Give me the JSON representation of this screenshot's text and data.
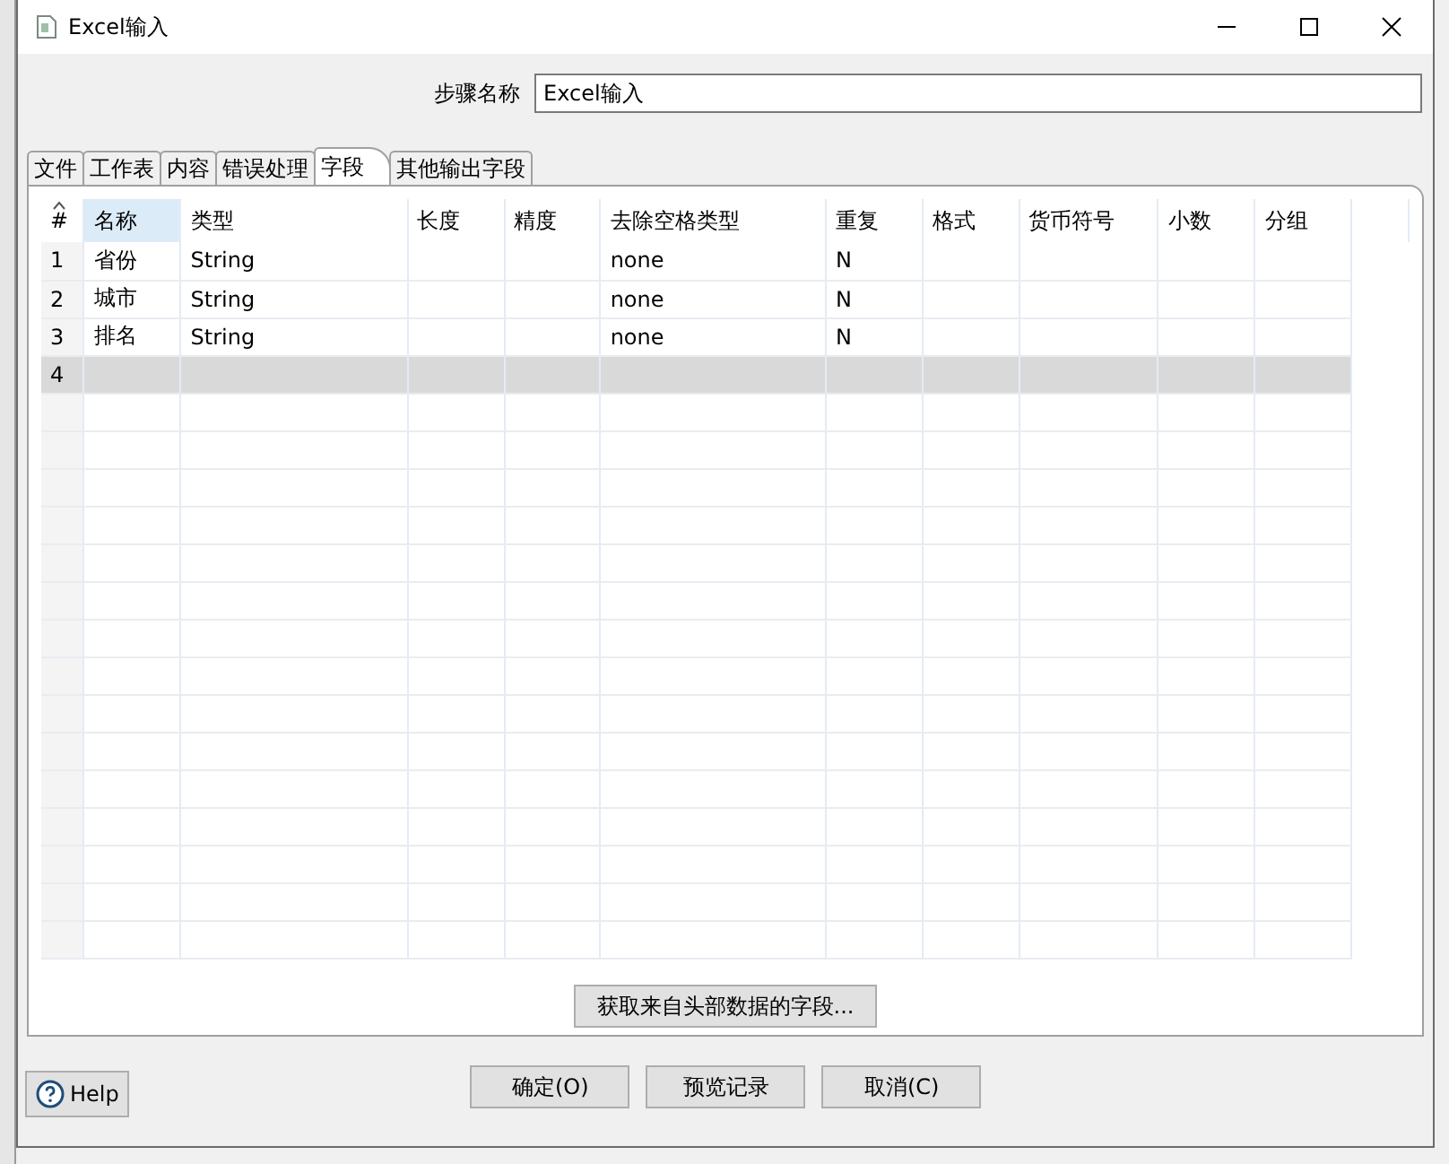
{
  "window": {
    "title": "Excel输入"
  },
  "step_name": {
    "label": "步骤名称",
    "value": "Excel输入"
  },
  "tabs": [
    {
      "label": "文件",
      "selected": false
    },
    {
      "label": "工作表",
      "selected": false
    },
    {
      "label": "内容",
      "selected": false
    },
    {
      "label": "错误处理",
      "selected": false
    },
    {
      "label": "字段",
      "selected": true
    },
    {
      "label": "其他输出字段",
      "selected": false
    }
  ],
  "table": {
    "columns": [
      "#",
      "名称",
      "类型",
      "长度",
      "精度",
      "去除空格类型",
      "重复",
      "格式",
      "货币符号",
      "小数",
      "分组"
    ],
    "rows": [
      {
        "selected": false,
        "cells": [
          "1",
          "省份",
          "String",
          "",
          "",
          "none",
          "N",
          "",
          "",
          "",
          ""
        ]
      },
      {
        "selected": false,
        "cells": [
          "2",
          "城市",
          "String",
          "",
          "",
          "none",
          "N",
          "",
          "",
          "",
          ""
        ]
      },
      {
        "selected": false,
        "cells": [
          "3",
          "排名",
          "String",
          "",
          "",
          "none",
          "N",
          "",
          "",
          "",
          ""
        ]
      },
      {
        "selected": true,
        "cells": [
          "4",
          "",
          "",
          "",
          "",
          "",
          "",
          "",
          "",
          "",
          ""
        ]
      }
    ]
  },
  "get_fields_button": "获取来自头部数据的字段...",
  "buttons": [
    "确定(O)",
    "预览记录",
    "取消(C)"
  ],
  "help_button": "Help"
}
